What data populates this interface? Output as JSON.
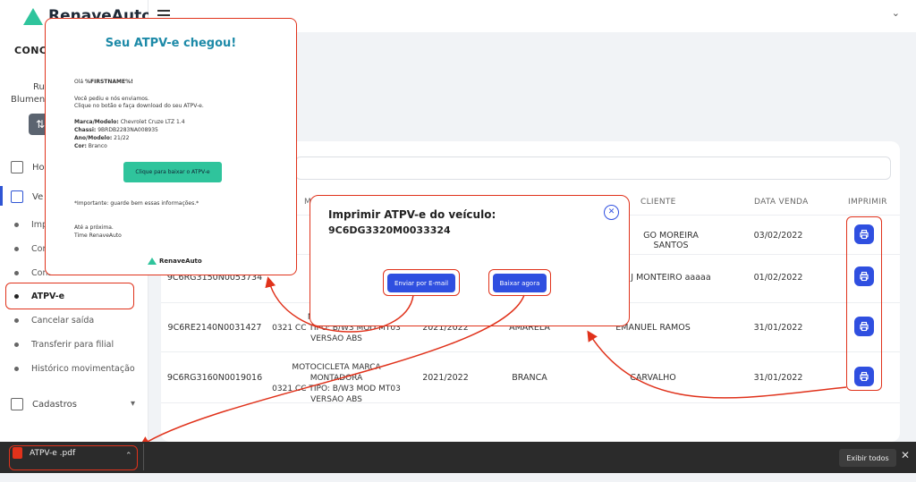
{
  "app": {
    "logo": "RenaveAuto"
  },
  "sidebar": {
    "org": "CONCE",
    "user_line1": "Ru",
    "user_line2": "Blumene",
    "switch_icon": "swap-icon",
    "home_label": "Hom",
    "vendas_label": "Ve",
    "sub_items": [
      "Imp",
      "Confirmar entrada",
      "Consultar saldo",
      "ATPV-e",
      "Cancelar saída",
      "Transferir para filial",
      "Histórico movimentação"
    ],
    "cadastros_label": "Cadastros"
  },
  "table": {
    "headers": [
      "M",
      "CLIENTE",
      "DATA VENDA",
      "IMPRIMIR"
    ],
    "rows": [
      {
        "chassi": "",
        "modelo": "",
        "ano": "",
        "cor": "",
        "cliente": "GO MOREIRA SANTOS",
        "data": "03/02/2022"
      },
      {
        "chassi": "9C6RG3150N0053734",
        "modelo": "CLE\n0321 CC T",
        "ano": "",
        "cor": "",
        "cliente": "J MONTEIRO aaaaa",
        "data": "01/02/2022"
      },
      {
        "chassi": "9C6RE2140N0031427",
        "modelo": "MOTOCICLETA\n0321 CC TIPO: B/W3 MOD MT03\nVERSAO ABS",
        "ano": "2021/2022",
        "cor": "AMARELA",
        "cliente": "EMANUEL RAMOS",
        "data": "31/01/2022"
      },
      {
        "chassi": "9C6RG3160N0019016",
        "modelo": "MOTOCICLETA MARCA MONTADORA\n0321 CC TIPO: B/W3 MOD MT03\nVERSAO ABS",
        "ano": "2021/2022",
        "cor": "BRANCA",
        "cliente": "CARVALHO",
        "data": "31/01/2022"
      }
    ]
  },
  "email": {
    "title": "Seu ATPV-e chegou!",
    "greeting_prefix": "Olá ",
    "greeting_name": "%FIRSTNAME%!",
    "line1": "Você pediu e nós enviamos.",
    "line2": "Clique no botão e faça download do seu ATPV-e.",
    "marca_label": "Marca/Modelo:",
    "marca_value": " Chevrolet Cruze LTZ 1.4",
    "chassi_label": "Chassi:",
    "chassi_value": " 9BRDB2283NA008935",
    "ano_label": "Ano/Modelo:",
    "ano_value": " 21/22",
    "cor_label": "Cor:",
    "cor_value": " Branco",
    "button": "Clique para baixar o ATPV-e",
    "important": "*Importante: guarde bem essas informações.*",
    "bye1": "Até a próxima.",
    "bye2": "Time RenaveAuto",
    "logo": "RenaveAuto"
  },
  "modal": {
    "title": "Imprimir ATPV-e do veículo:",
    "vin": "9C6DG3320M0033324",
    "email_button": "Enviar por E-mail",
    "download_button": "Baixar agora"
  },
  "download_bar": {
    "file": "ATPV-e .pdf",
    "show_all": "Exibir todos",
    "close": "✕"
  },
  "colors": {
    "accent": "#2f4fe0",
    "brand": "#2fc49c",
    "highlight": "#e0321b"
  }
}
